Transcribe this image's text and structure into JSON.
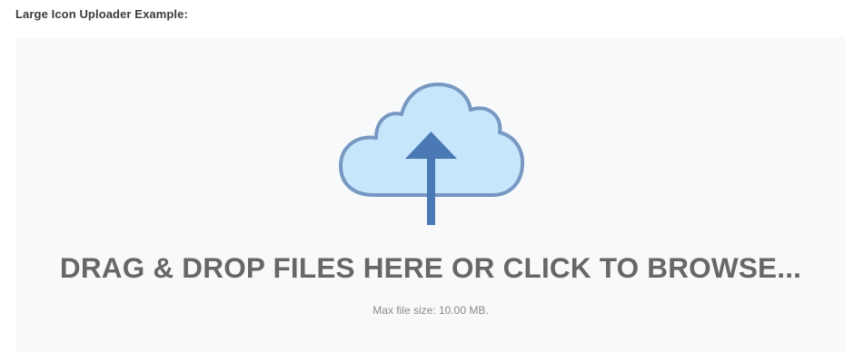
{
  "header": {
    "title": "Large Icon Uploader Example:"
  },
  "uploader": {
    "icon": "cloud-upload-icon",
    "drop_label": "DRAG & DROP FILES HERE OR CLICK TO BROWSE...",
    "max_size_label": "Max file size: 10.00 MB."
  },
  "colors": {
    "cloud_fill": "#c6e6fb",
    "cloud_stroke": "#7698c2",
    "arrow": "#4a79b5",
    "dropzone_bg": "#f8f9fb",
    "text_main": "#676767"
  }
}
